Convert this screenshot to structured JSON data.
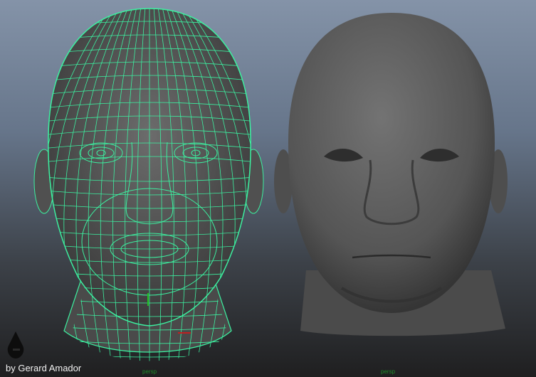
{
  "viewports": [
    {
      "label": "persp",
      "mode": "wireframe-on-shaded"
    },
    {
      "label": "persp",
      "mode": "smooth-shaded"
    }
  ],
  "credit": "by Gerard Amador",
  "colors": {
    "wire": "#3cf0a0",
    "head": "#5a5a5a",
    "axis_y": "#22c022",
    "axis_x": "#c02020"
  }
}
